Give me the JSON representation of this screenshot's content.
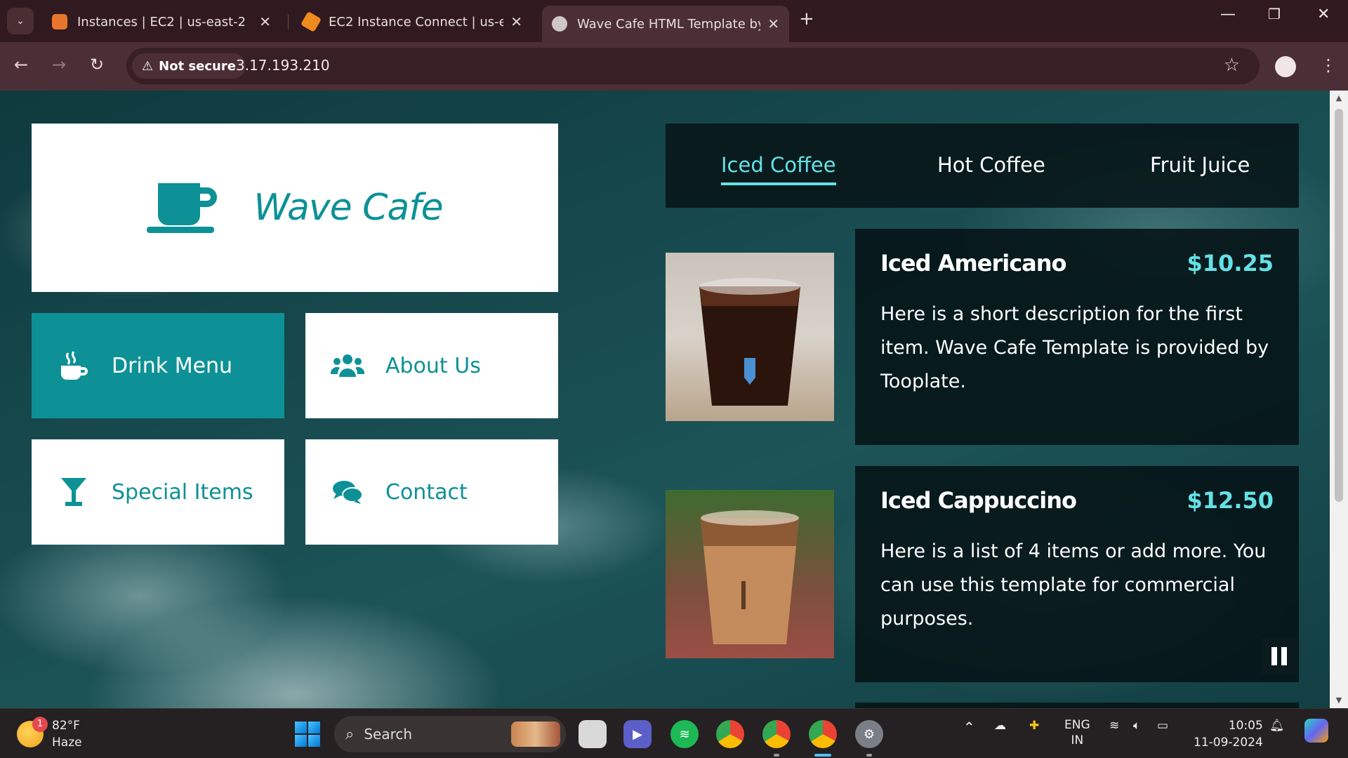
{
  "browser": {
    "tabs": [
      {
        "title": "Instances | EC2 | us-east-2",
        "favicon_color": "#e7762c"
      },
      {
        "title": "EC2 Instance Connect | us-east-",
        "favicon_color": "#ef8a1c"
      },
      {
        "title": "Wave Cafe HTML Template by T",
        "favicon_color": "#cfc6c6",
        "active": true
      }
    ],
    "security_label": "Not secure",
    "url": "3.17.193.210"
  },
  "site": {
    "brand": "Wave Cafe",
    "accent": "#0d9196",
    "nav": [
      {
        "label": "Drink Menu",
        "icon": "mug-hot-icon",
        "active": true
      },
      {
        "label": "About Us",
        "icon": "users-icon"
      },
      {
        "label": "Special Items",
        "icon": "cocktail-glass-icon"
      },
      {
        "label": "Contact",
        "icon": "chat-bubbles-icon"
      }
    ],
    "menu_tabs": [
      {
        "label": "Iced Coffee",
        "active": true
      },
      {
        "label": "Hot Coffee"
      },
      {
        "label": "Fruit Juice"
      }
    ],
    "items": [
      {
        "name": "Iced Americano",
        "price": "$10.25",
        "description": "Here is a short description for the first item. Wave Cafe Template is provided by Tooplate."
      },
      {
        "name": "Iced Cappuccino",
        "price": "$12.50",
        "description": "Here is a list of 4 items or add more. You can use this template for commercial purposes."
      }
    ]
  },
  "taskbar": {
    "weather_temp": "82°F",
    "weather_desc": "Haze",
    "weather_badge": "1",
    "search_label": "Search",
    "lang_top": "ENG",
    "lang_bottom": "IN",
    "time": "10:05",
    "date": "11-09-2024"
  }
}
